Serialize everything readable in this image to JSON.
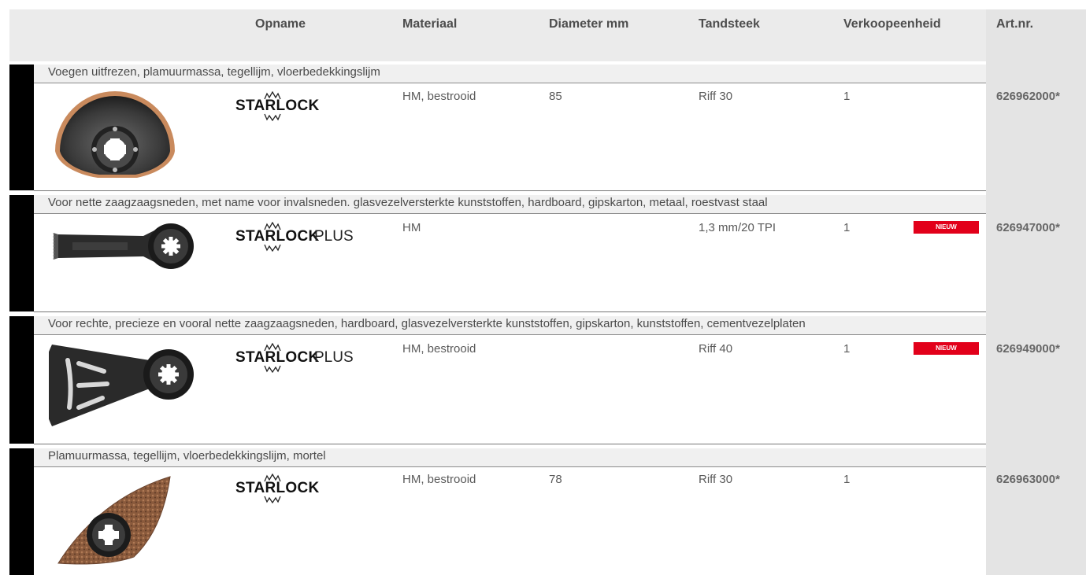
{
  "header": {
    "opname": "Opname",
    "materiaal": "Materiaal",
    "diameter": "Diameter mm",
    "tandsteek": "Tandsteek",
    "verkoopeenheid": "Verkoopeenheid",
    "artnr": "Art.nr."
  },
  "colors": {
    "accent_red": "#e2001a",
    "header_bg": "#ebebeb",
    "artnr_bg": "#e4e4e4",
    "bar": "#000000"
  },
  "products": [
    {
      "description": "Voegen uitfrezen, plamuurmassa, tegellijm, vloerbedekkingslijm",
      "logo": "STARLOCK",
      "logo_suffix": "",
      "materiaal": "HM, bestrooid",
      "diameter": "85",
      "tandsteek": "Riff 30",
      "verkoopeenheid": "1",
      "badge": "",
      "artnr": "626962000*",
      "image_icon": "segment-saw-blade-icon"
    },
    {
      "description": "Voor nette zaagzaagsneden, met name voor invalsneden. glasvezelversterkte kunststoffen, hardboard, gipskarton, metaal, roestvast staal",
      "logo": "STARLOCK",
      "logo_suffix": "PLUS",
      "materiaal": "HM",
      "diameter": "",
      "tandsteek": "1,3 mm/20 TPI",
      "verkoopeenheid": "1",
      "badge": "NIEUW",
      "artnr": "626947000*",
      "image_icon": "plunge-cut-blade-icon"
    },
    {
      "description": "Voor rechte, precieze en vooral nette zaagzaagsneden, hardboard, glasvezelversterkte kunststoffen, gipskarton, kunststoffen, cementvezelplaten",
      "logo": "STARLOCK",
      "logo_suffix": "PLUS",
      "materiaal": "HM, bestrooid",
      "diameter": "",
      "tandsteek": "Riff 40",
      "verkoopeenheid": "1",
      "badge": "NIEUW",
      "artnr": "626949000*",
      "image_icon": "fan-segment-blade-icon"
    },
    {
      "description": "Plamuurmassa, tegellijm, vloerbedekkingslijm, mortel",
      "logo": "STARLOCK",
      "logo_suffix": "",
      "materiaal": "HM, bestrooid",
      "diameter": "78",
      "tandsteek": "Riff 30",
      "verkoopeenheid": "1",
      "badge": "",
      "artnr": "626963000*",
      "image_icon": "triangular-rasp-icon"
    }
  ]
}
